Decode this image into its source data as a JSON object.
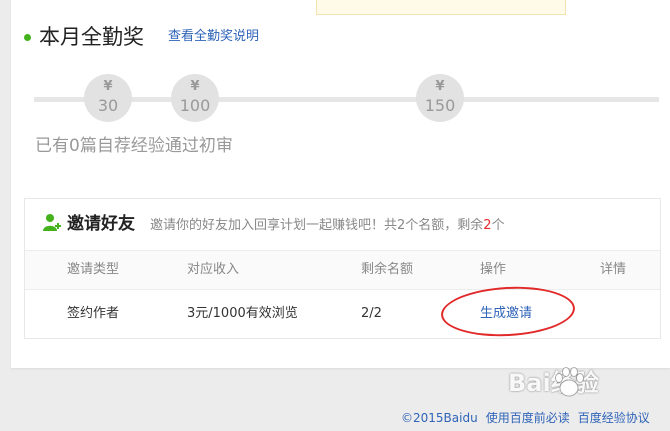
{
  "award": {
    "title": "本月全勤奖",
    "link": "查看全勤奖说明",
    "milestones": [
      {
        "symbol": "¥",
        "amount": "30"
      },
      {
        "symbol": "¥",
        "amount": "100"
      },
      {
        "symbol": "¥",
        "amount": "150"
      }
    ],
    "progress_text": "已有0篇自荐经验通过初审"
  },
  "invite": {
    "title": "邀请好友",
    "desc_prefix": "邀请你的好友加入回享计划一起赚钱吧！共2个名额，剩余",
    "remaining": "2",
    "desc_suffix": "个",
    "columns": [
      "邀请类型",
      "对应收入",
      "剩余名额",
      "操作",
      "详情"
    ],
    "rows": [
      {
        "type": "签约作者",
        "income": "3元/1000有效浏览",
        "quota": "2/2",
        "action": "生成邀请",
        "detail": ""
      }
    ]
  },
  "footer": {
    "links": [
      "©2015Baidu",
      "使用百度前必读",
      "百度经验协议"
    ]
  },
  "watermark": {
    "text": "Bai经验"
  },
  "colors": {
    "accent": "#2f64b8",
    "highlight": "#e22a2a",
    "dot": "#43b21c"
  }
}
